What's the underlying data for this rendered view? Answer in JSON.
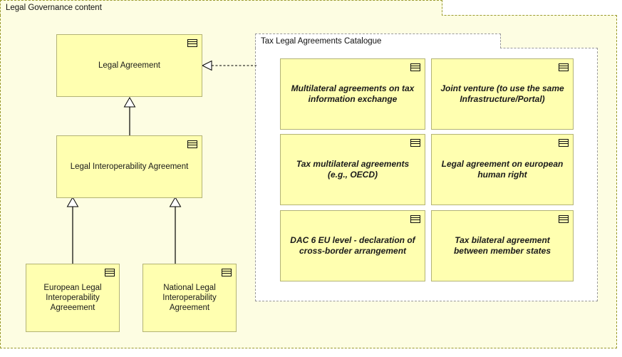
{
  "diagram": {
    "title": "Legal Governance content",
    "icon_name": "contract-icon"
  },
  "groups": [
    {
      "id": "legal-governance-content",
      "label": "Legal Governance content",
      "border_color": "#9a9a2e",
      "fill_color": "#fdfde2",
      "border_style": "dashed"
    },
    {
      "id": "tax-legal-agreements-catalogue",
      "label": "Tax Legal Agreements Catalogue",
      "border_color": "#9a9a9a",
      "fill_color": "#ffffff",
      "border_style": "dashed"
    }
  ],
  "nodes": {
    "legal_agreement": {
      "label": "Legal Agreement",
      "style": "plain",
      "fill_color": "#ffffb0",
      "border_color": "#b3b375"
    },
    "legal_interoperability_agreement": {
      "label": "Legal Interoperability Agreement",
      "style": "plain",
      "fill_color": "#ffffb0",
      "border_color": "#b3b375"
    },
    "european_legal_interoperability_agreement": {
      "label": "European Legal Interoperability Agreeement",
      "style": "plain",
      "fill_color": "#ffffb0",
      "border_color": "#b3b375"
    },
    "national_legal_interoperability_agreement": {
      "label": "National Legal Interoperability Agreement",
      "style": "plain",
      "fill_color": "#ffffb0",
      "border_color": "#b3b375"
    },
    "multilateral_tax_info_exchange": {
      "label": "Multilateral agreements on tax information exchange",
      "style": "emphasis",
      "fill_color": "#ffffb0",
      "border_color": "#b3b375"
    },
    "joint_venture_infrastructure": {
      "label": "Joint venture (to use the same Infrastructure/Portal)",
      "style": "emphasis",
      "fill_color": "#ffffb0",
      "border_color": "#b3b375"
    },
    "tax_multilateral_oecd": {
      "label": "Tax multilateral agreements (e.g., OECD)",
      "style": "emphasis",
      "fill_color": "#ffffb0",
      "border_color": "#b3b375"
    },
    "legal_agreement_human_right": {
      "label": "Legal agreement on european human right",
      "style": "emphasis",
      "fill_color": "#ffffb0",
      "border_color": "#b3b375"
    },
    "dac6_eu_level": {
      "label": "DAC 6 EU level - declaration of cross-border arrangement",
      "style": "emphasis",
      "fill_color": "#ffffb0",
      "border_color": "#b3b375"
    },
    "tax_bilateral_member_states": {
      "label": "Tax bilateral agreement between member states",
      "style": "emphasis",
      "fill_color": "#ffffb0",
      "border_color": "#b3b375"
    }
  },
  "connectors": [
    {
      "id": "generalization-interop-to-agreement",
      "type": "generalization",
      "line": "solid",
      "arrowhead": "hollow-triangle",
      "from": "legal_interoperability_agreement",
      "to": "legal_agreement"
    },
    {
      "id": "generalization-european-to-interop",
      "type": "generalization",
      "line": "solid",
      "arrowhead": "hollow-triangle",
      "from": "european_legal_interoperability_agreement",
      "to": "legal_interoperability_agreement"
    },
    {
      "id": "generalization-national-to-interop",
      "type": "generalization",
      "line": "solid",
      "arrowhead": "hollow-triangle",
      "from": "national_legal_interoperability_agreement",
      "to": "legal_interoperability_agreement"
    },
    {
      "id": "realization-catalogue-to-agreement",
      "type": "realization",
      "line": "dashed",
      "arrowhead": "hollow-triangle",
      "from": "tax-legal-agreements-catalogue",
      "to": "legal_agreement"
    }
  ]
}
